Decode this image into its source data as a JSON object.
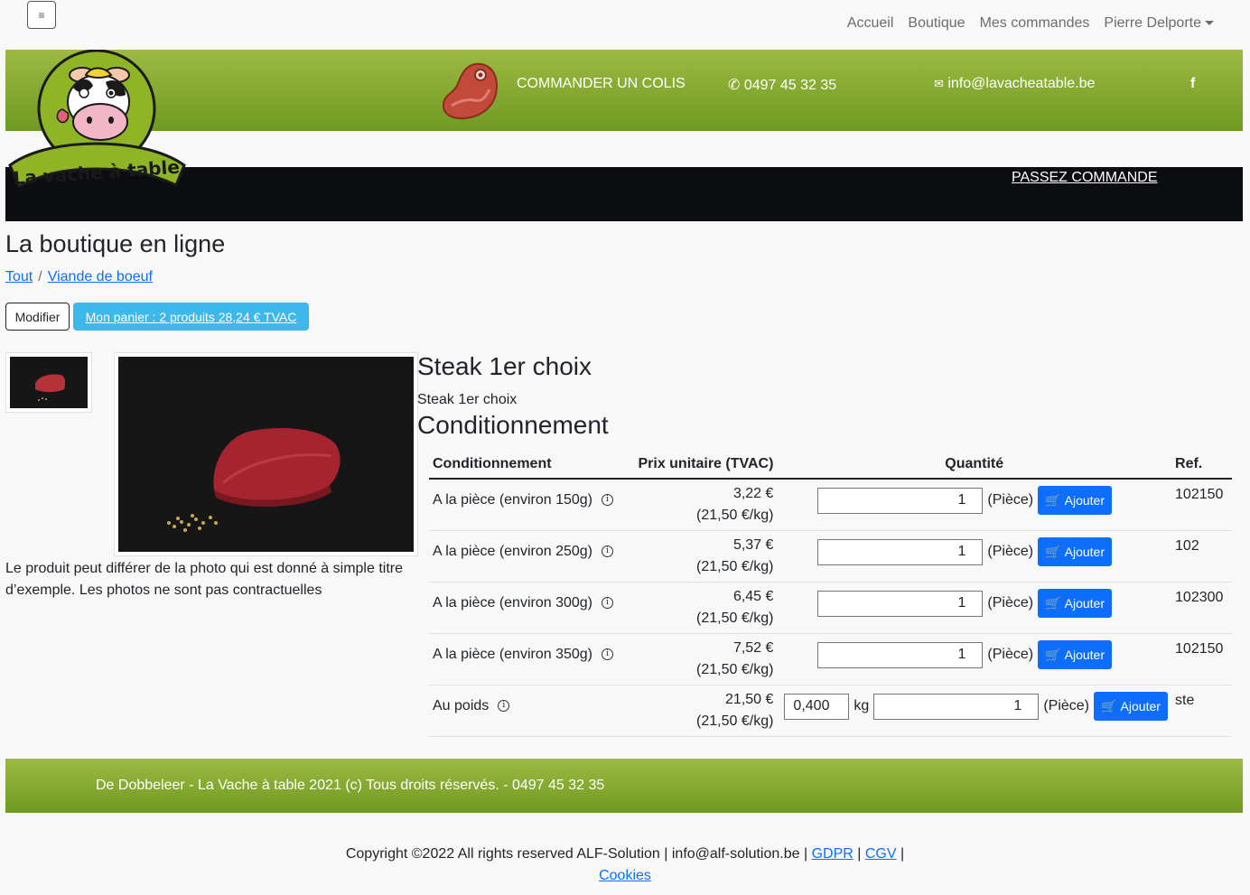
{
  "nav": {
    "toggle_icon": "≡",
    "links": [
      "Accueil",
      "Boutique",
      "Mes commandes"
    ],
    "user": "Pierre Delporte"
  },
  "header": {
    "logo_text": "La vache à table",
    "order_box": "COMMANDER UN COLIS",
    "phone": "0497 45 32 35",
    "email": "info@lavacheatable.be",
    "social": "f",
    "passez": "PASSEZ COMMANDE"
  },
  "shop": {
    "title": "La boutique en ligne",
    "breadcrumb": [
      "Tout",
      "Viande de boeuf"
    ],
    "modify": "Modifier",
    "cart": "Mon panier : 2 produits 28,24 € TVAC"
  },
  "product": {
    "title": "Steak 1er choix",
    "subtitle": "Steak 1er choix",
    "disclaimer": "Le produit peut différer de la photo qui est donné à simple titre d’exemple. Les photos ne sont pas contractuelles",
    "cond_heading": "Conditionnement"
  },
  "table": {
    "headers": [
      "Conditionnement",
      "Prix unitaire (TVAC)",
      "Quantité",
      "Ref."
    ],
    "add_label": "Ajouter",
    "unit_label": "(Pièce)",
    "kg_label": "kg",
    "rows": [
      {
        "label": "A la pièce (environ 150g)",
        "price": "3,22 €",
        "per_kg": "(21,50 €/kg)",
        "qty": "1",
        "ref": "102150"
      },
      {
        "label": "A la pièce (environ 250g)",
        "price": "5,37 €",
        "per_kg": "(21,50 €/kg)",
        "qty": "1",
        "ref": "102"
      },
      {
        "label": "A la pièce (environ 300g)",
        "price": "6,45 €",
        "per_kg": "(21,50 €/kg)",
        "qty": "1",
        "ref": "102300"
      },
      {
        "label": "A la pièce (environ 350g)",
        "price": "7,52 €",
        "per_kg": "(21,50 €/kg)",
        "qty": "1",
        "ref": "102150"
      }
    ],
    "weight_row": {
      "label": "Au poids",
      "price": "21,50 €",
      "per_kg": "(21,50 €/kg)",
      "kg": "0,400",
      "qty": "1",
      "ref": "ste"
    }
  },
  "footer": {
    "text": "De Dobbeleer - La Vache à table 2021 (c) Tous droits réservés. - 0497 45 32 35",
    "copyright": "Copyright ©2022 All rights reserved ALF-Solution | info@alf-solution.be |",
    "gdpr": "GDPR",
    "cgv": "CGV",
    "cookies": "Cookies"
  },
  "colors": {
    "green_top": "#9dba42",
    "green_bottom": "#6f9a21",
    "primary": "#0d6efd",
    "cart_btn": "#3cb8ea",
    "black_bar": "#0c0d10"
  }
}
